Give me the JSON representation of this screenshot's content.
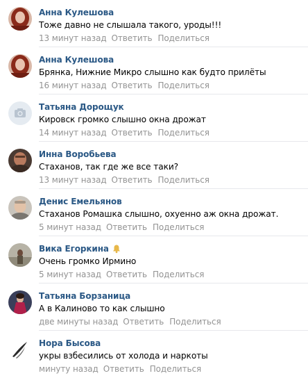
{
  "comments": [
    {
      "author": "Анна Кулешова",
      "text": "Тоже давно не слышала такого, уроды!!!",
      "time": "13 минут назад",
      "reply_label": "Ответить",
      "share_label": "Поделиться",
      "avatar_icon": "avatar-photo-woman-red-hair",
      "has_bell": false
    },
    {
      "author": "Анна Кулешова",
      "text": "Брянка, Нижние Микро слышно как будто прилёты",
      "time": "16 минут назад",
      "reply_label": "Ответить",
      "share_label": "Поделиться",
      "avatar_icon": "avatar-photo-woman-red-hair",
      "has_bell": false
    },
    {
      "author": "Татьяна Дорощук",
      "text": "Кировск громко слышно окна дрожат",
      "time": "14 минут назад",
      "reply_label": "Ответить",
      "share_label": "Поделиться",
      "avatar_icon": "camera-placeholder-icon",
      "has_bell": false
    },
    {
      "author": "Инна Воробьева",
      "text": "Стаханов, так где же все таки?",
      "time": "13 минут назад",
      "reply_label": "Ответить",
      "share_label": "Поделиться",
      "avatar_icon": "avatar-photo-man-dark",
      "has_bell": false
    },
    {
      "author": "Денис Емельянов",
      "text": "Стаханов Ромашка слышно, охуенно аж окна дрожат.",
      "time": "5 минут назад",
      "reply_label": "Ответить",
      "share_label": "Поделиться",
      "avatar_icon": "avatar-photo-man-light",
      "has_bell": false
    },
    {
      "author": "Вика Егоркина",
      "text": "Очень громко Ирмино",
      "time": "5 минут назад",
      "reply_label": "Ответить",
      "share_label": "Поделиться",
      "avatar_icon": "avatar-photo-outdoor",
      "has_bell": true
    },
    {
      "author": "Татьяна Борзаница",
      "text": "А в Калиново то как слышно",
      "time": "две минуты назад",
      "reply_label": "Ответить",
      "share_label": "Поделиться",
      "avatar_icon": "avatar-photo-woman-red-dress",
      "has_bell": false
    },
    {
      "author": "Нора Бысова",
      "text": "укры взбесились от холода и наркоты",
      "time": "минуту назад",
      "reply_label": "Ответить",
      "share_label": "Поделиться",
      "avatar_icon": "avatar-photo-feather",
      "has_bell": false
    }
  ],
  "colors": {
    "author": "#2a5885",
    "meta": "#939393",
    "text": "#000000",
    "divider": "#e7e8ec",
    "bell": "#e8b84a"
  }
}
